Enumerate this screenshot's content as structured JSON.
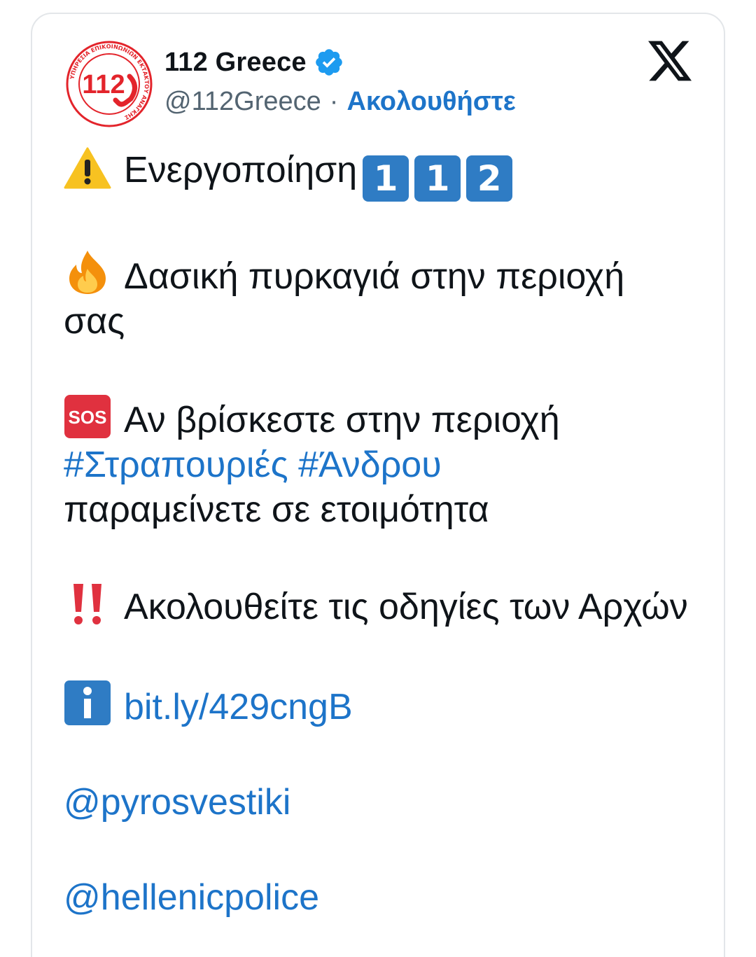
{
  "tweet": {
    "display_name": "112 Greece",
    "handle": "@112Greece",
    "separator": "·",
    "follow_label": "Ακολουθήστε",
    "avatar_number": "112",
    "avatar_ring_text": "ΥΠΗΡΕΣΙΑ ΕΠΙΚΟΙΝΩΝΙΩΝ ΕΚΤΑΚΤΟΥ ΑΝΑΓΚΗΣ",
    "lines": {
      "activation": "Ενεργοποίηση",
      "keycaps": [
        "1",
        "1",
        "2"
      ],
      "fire": "Δασική πυρκαγιά στην περιοχή σας",
      "sos_label": "SOS",
      "sos_text": "Αν βρίσκεστε στην περιοχή",
      "hashtag1": "#Στραπουριές",
      "hashtag2": "#Άνδρου",
      "ready": "παραμείνετε σε ετοιμότητα",
      "instructions": "Ακολουθείτε τις οδηγίες των Αρχών",
      "info_link": "bit.ly/429cngB",
      "mention1": "@pyrosvestiki",
      "mention2": "@hellenicpolice"
    }
  },
  "colors": {
    "link": "#1d74c9",
    "verified": "#1d9bf0",
    "keycap": "#2f7cc4",
    "avatar_red": "#e3242b",
    "sos_red": "#e0313f"
  },
  "icons": [
    "avatar-logo",
    "verified-badge-icon",
    "x-logo-icon",
    "warning-icon",
    "keycap-icon",
    "fire-icon",
    "sos-icon",
    "double-exclamation-icon",
    "info-icon"
  ]
}
